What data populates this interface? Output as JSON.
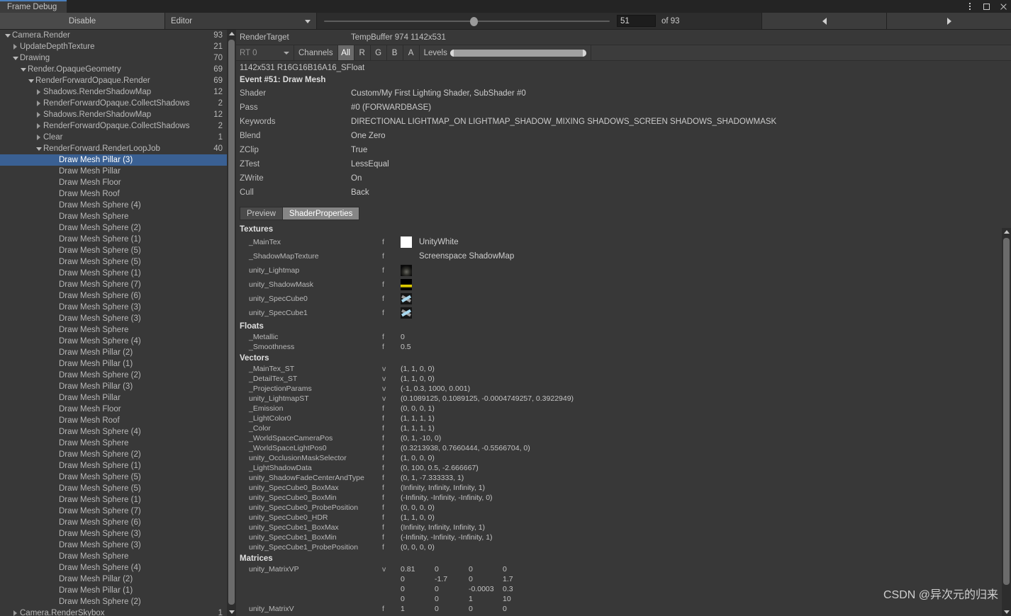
{
  "window": {
    "tab_title": "Frame Debug",
    "controls": [
      {
        "name": "more-menu",
        "glyph": "dots"
      },
      {
        "name": "maximize",
        "glyph": "square"
      },
      {
        "name": "close",
        "glyph": "x"
      }
    ]
  },
  "toolbar": {
    "disable_label": "Disable",
    "target_dropdown": "Editor",
    "event_index": "51",
    "of_label": "of 93",
    "prev_label": "◀",
    "next_label": "▶"
  },
  "tree": {
    "rows": [
      {
        "label": "Camera.Render",
        "value": "93",
        "indent": 0,
        "toggle": "open"
      },
      {
        "label": "UpdateDepthTexture",
        "value": "21",
        "indent": 1,
        "toggle": "closed"
      },
      {
        "label": "Drawing",
        "value": "70",
        "indent": 1,
        "toggle": "open"
      },
      {
        "label": "Render.OpaqueGeometry",
        "value": "69",
        "indent": 2,
        "toggle": "open"
      },
      {
        "label": "RenderForwardOpaque.Render",
        "value": "69",
        "indent": 3,
        "toggle": "open"
      },
      {
        "label": "Shadows.RenderShadowMap",
        "value": "12",
        "indent": 4,
        "toggle": "closed"
      },
      {
        "label": "RenderForwardOpaque.CollectShadows",
        "value": "2",
        "indent": 4,
        "toggle": "closed"
      },
      {
        "label": "Shadows.RenderShadowMap",
        "value": "12",
        "indent": 4,
        "toggle": "closed"
      },
      {
        "label": "RenderForwardOpaque.CollectShadows",
        "value": "2",
        "indent": 4,
        "toggle": "closed"
      },
      {
        "label": "Clear",
        "value": "1",
        "indent": 4,
        "toggle": "closed"
      },
      {
        "label": "RenderForward.RenderLoopJob",
        "value": "40",
        "indent": 4,
        "toggle": "open"
      },
      {
        "label": "Draw Mesh Pillar (3)",
        "value": "",
        "indent": 6,
        "toggle": "none",
        "selected": true
      },
      {
        "label": "Draw Mesh Pillar",
        "value": "",
        "indent": 6,
        "toggle": "none"
      },
      {
        "label": "Draw Mesh Floor",
        "value": "",
        "indent": 6,
        "toggle": "none"
      },
      {
        "label": "Draw Mesh Roof",
        "value": "",
        "indent": 6,
        "toggle": "none"
      },
      {
        "label": "Draw Mesh Sphere (4)",
        "value": "",
        "indent": 6,
        "toggle": "none"
      },
      {
        "label": "Draw Mesh Sphere",
        "value": "",
        "indent": 6,
        "toggle": "none"
      },
      {
        "label": "Draw Mesh Sphere (2)",
        "value": "",
        "indent": 6,
        "toggle": "none"
      },
      {
        "label": "Draw Mesh Sphere (1)",
        "value": "",
        "indent": 6,
        "toggle": "none"
      },
      {
        "label": "Draw Mesh Sphere (5)",
        "value": "",
        "indent": 6,
        "toggle": "none"
      },
      {
        "label": "Draw Mesh Sphere (5)",
        "value": "",
        "indent": 6,
        "toggle": "none"
      },
      {
        "label": "Draw Mesh Sphere (1)",
        "value": "",
        "indent": 6,
        "toggle": "none"
      },
      {
        "label": "Draw Mesh Sphere (7)",
        "value": "",
        "indent": 6,
        "toggle": "none"
      },
      {
        "label": "Draw Mesh Sphere (6)",
        "value": "",
        "indent": 6,
        "toggle": "none"
      },
      {
        "label": "Draw Mesh Sphere (3)",
        "value": "",
        "indent": 6,
        "toggle": "none"
      },
      {
        "label": "Draw Mesh Sphere (3)",
        "value": "",
        "indent": 6,
        "toggle": "none"
      },
      {
        "label": "Draw Mesh Sphere",
        "value": "",
        "indent": 6,
        "toggle": "none"
      },
      {
        "label": "Draw Mesh Sphere (4)",
        "value": "",
        "indent": 6,
        "toggle": "none"
      },
      {
        "label": "Draw Mesh Pillar (2)",
        "value": "",
        "indent": 6,
        "toggle": "none"
      },
      {
        "label": "Draw Mesh Pillar (1)",
        "value": "",
        "indent": 6,
        "toggle": "none"
      },
      {
        "label": "Draw Mesh Sphere (2)",
        "value": "",
        "indent": 6,
        "toggle": "none"
      },
      {
        "label": "Draw Mesh Pillar (3)",
        "value": "",
        "indent": 6,
        "toggle": "none"
      },
      {
        "label": "Draw Mesh Pillar",
        "value": "",
        "indent": 6,
        "toggle": "none"
      },
      {
        "label": "Draw Mesh Floor",
        "value": "",
        "indent": 6,
        "toggle": "none"
      },
      {
        "label": "Draw Mesh Roof",
        "value": "",
        "indent": 6,
        "toggle": "none"
      },
      {
        "label": "Draw Mesh Sphere (4)",
        "value": "",
        "indent": 6,
        "toggle": "none"
      },
      {
        "label": "Draw Mesh Sphere",
        "value": "",
        "indent": 6,
        "toggle": "none"
      },
      {
        "label": "Draw Mesh Sphere (2)",
        "value": "",
        "indent": 6,
        "toggle": "none"
      },
      {
        "label": "Draw Mesh Sphere (1)",
        "value": "",
        "indent": 6,
        "toggle": "none"
      },
      {
        "label": "Draw Mesh Sphere (5)",
        "value": "",
        "indent": 6,
        "toggle": "none"
      },
      {
        "label": "Draw Mesh Sphere (5)",
        "value": "",
        "indent": 6,
        "toggle": "none"
      },
      {
        "label": "Draw Mesh Sphere (1)",
        "value": "",
        "indent": 6,
        "toggle": "none"
      },
      {
        "label": "Draw Mesh Sphere (7)",
        "value": "",
        "indent": 6,
        "toggle": "none"
      },
      {
        "label": "Draw Mesh Sphere (6)",
        "value": "",
        "indent": 6,
        "toggle": "none"
      },
      {
        "label": "Draw Mesh Sphere (3)",
        "value": "",
        "indent": 6,
        "toggle": "none"
      },
      {
        "label": "Draw Mesh Sphere (3)",
        "value": "",
        "indent": 6,
        "toggle": "none"
      },
      {
        "label": "Draw Mesh Sphere",
        "value": "",
        "indent": 6,
        "toggle": "none"
      },
      {
        "label": "Draw Mesh Sphere (4)",
        "value": "",
        "indent": 6,
        "toggle": "none"
      },
      {
        "label": "Draw Mesh Pillar (2)",
        "value": "",
        "indent": 6,
        "toggle": "none"
      },
      {
        "label": "Draw Mesh Pillar (1)",
        "value": "",
        "indent": 6,
        "toggle": "none"
      },
      {
        "label": "Draw Mesh Sphere (2)",
        "value": "",
        "indent": 6,
        "toggle": "none"
      },
      {
        "label": "Camera.RenderSkybox",
        "value": "1",
        "indent": 1,
        "toggle": "closed"
      }
    ]
  },
  "rendertarget": {
    "label": "RenderTarget",
    "buffer": "TempBuffer 974 1142x531",
    "rt_select": "RT 0",
    "channels_label": "Channels",
    "channels": [
      "All",
      "R",
      "G",
      "B",
      "A"
    ],
    "channel_active": "All",
    "levels_label": "Levels",
    "format": "1142x531 R16G16B16A16_SFloat"
  },
  "event": {
    "title": "Event #51: Draw Mesh",
    "rows": [
      {
        "key": "Shader",
        "value": "Custom/My First Lighting Shader, SubShader #0"
      },
      {
        "key": "Pass",
        "value": "#0 (FORWARDBASE)"
      },
      {
        "key": "Keywords",
        "value": "DIRECTIONAL LIGHTMAP_ON LIGHTMAP_SHADOW_MIXING SHADOWS_SCREEN SHADOWS_SHADOWMASK"
      },
      {
        "key": "Blend",
        "value": "One Zero"
      },
      {
        "key": "ZClip",
        "value": "True"
      },
      {
        "key": "ZTest",
        "value": "LessEqual"
      },
      {
        "key": "ZWrite",
        "value": "On"
      },
      {
        "key": "Cull",
        "value": "Back"
      }
    ]
  },
  "tabs": [
    {
      "label": "Preview",
      "active": false
    },
    {
      "label": "ShaderProperties",
      "active": true
    }
  ],
  "properties": {
    "textures_title": "Textures",
    "textures": [
      {
        "name": "_MainTex",
        "type": "f",
        "thumb": "white",
        "text": "UnityWhite"
      },
      {
        "name": "_ShadowMapTexture",
        "type": "f",
        "thumb": "none",
        "text": "Screenspace ShadowMap"
      },
      {
        "name": "unity_Lightmap",
        "type": "f",
        "thumb": "lightmap",
        "text": ""
      },
      {
        "name": "unity_ShadowMask",
        "type": "f",
        "thumb": "shadowmask",
        "text": ""
      },
      {
        "name": "unity_SpecCube0",
        "type": "f",
        "thumb": "cubemap",
        "text": ""
      },
      {
        "name": "unity_SpecCube1",
        "type": "f",
        "thumb": "cubemap",
        "text": ""
      }
    ],
    "floats_title": "Floats",
    "floats": [
      {
        "name": "_Metallic",
        "type": "f",
        "value": "0"
      },
      {
        "name": "_Smoothness",
        "type": "f",
        "value": "0.5"
      }
    ],
    "vectors_title": "Vectors",
    "vectors": [
      {
        "name": "_MainTex_ST",
        "type": "v",
        "value": "(1, 1, 0, 0)"
      },
      {
        "name": "_DetailTex_ST",
        "type": "v",
        "value": "(1, 1, 0, 0)"
      },
      {
        "name": "_ProjectionParams",
        "type": "v",
        "value": "(-1, 0.3, 1000, 0.001)"
      },
      {
        "name": "unity_LightmapST",
        "type": "v",
        "value": "(0.1089125, 0.1089125, -0.0004749257, 0.3922949)"
      },
      {
        "name": "_Emission",
        "type": "f",
        "value": "(0, 0, 0, 1)"
      },
      {
        "name": "_LightColor0",
        "type": "f",
        "value": "(1, 1, 1, 1)"
      },
      {
        "name": "_Color",
        "type": "f",
        "value": "(1, 1, 1, 1)"
      },
      {
        "name": "_WorldSpaceCameraPos",
        "type": "f",
        "value": "(0, 1, -10, 0)"
      },
      {
        "name": "_WorldSpaceLightPos0",
        "type": "f",
        "value": "(0.3213938, 0.7660444, -0.5566704, 0)"
      },
      {
        "name": "unity_OcclusionMaskSelector",
        "type": "f",
        "value": "(1, 0, 0, 0)"
      },
      {
        "name": "_LightShadowData",
        "type": "f",
        "value": "(0, 100, 0.5, -2.666667)"
      },
      {
        "name": "unity_ShadowFadeCenterAndType",
        "type": "f",
        "value": "(0, 1, -7.333333, 1)"
      },
      {
        "name": "unity_SpecCube0_BoxMax",
        "type": "f",
        "value": "(Infinity, Infinity, Infinity, 1)"
      },
      {
        "name": "unity_SpecCube0_BoxMin",
        "type": "f",
        "value": "(-Infinity, -Infinity, -Infinity, 0)"
      },
      {
        "name": "unity_SpecCube0_ProbePosition",
        "type": "f",
        "value": "(0, 0, 0, 0)"
      },
      {
        "name": "unity_SpecCube0_HDR",
        "type": "f",
        "value": "(1, 1, 0, 0)"
      },
      {
        "name": "unity_SpecCube1_BoxMax",
        "type": "f",
        "value": "(Infinity, Infinity, Infinity, 1)"
      },
      {
        "name": "unity_SpecCube1_BoxMin",
        "type": "f",
        "value": "(-Infinity, -Infinity, -Infinity, 1)"
      },
      {
        "name": "unity_SpecCube1_ProbePosition",
        "type": "f",
        "value": "(0, 0, 0, 0)"
      }
    ],
    "matrices_title": "Matrices",
    "matrices": [
      {
        "name": "unity_MatrixVP",
        "type": "v",
        "rows": [
          [
            "0.81",
            "0",
            "0",
            "0"
          ],
          [
            "0",
            "-1.7",
            "0",
            "1.7"
          ],
          [
            "0",
            "0",
            "-0.0003",
            "0.3"
          ],
          [
            "0",
            "0",
            "1",
            "10"
          ]
        ]
      },
      {
        "name": "unity_MatrixV",
        "type": "f",
        "rows": [
          [
            "1",
            "0",
            "0",
            "0"
          ]
        ]
      }
    ]
  },
  "watermark": "CSDN @异次元的归来"
}
